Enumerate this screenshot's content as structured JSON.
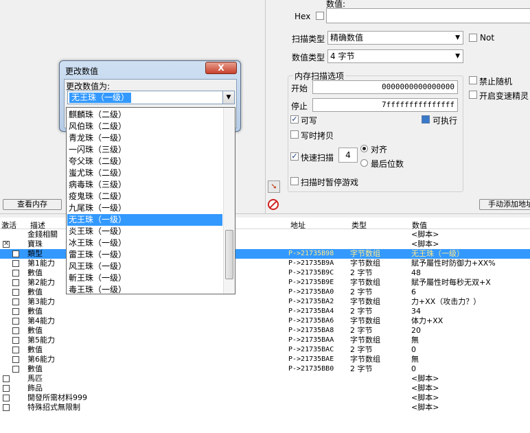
{
  "left_panel": {
    "view_memory_button": "查看内存"
  },
  "right_panel": {
    "value_label": "数值:",
    "hex_label": "Hex",
    "hex_checked": false,
    "scan_type_label": "扫描类型",
    "scan_type_value": "精确数值",
    "not_label": "Not",
    "value_type_label": "数值类型",
    "value_type_value": "4 字节",
    "mem_options_title": "内存扫描选项",
    "start_label": "开始",
    "start_value": "0000000000000000",
    "stop_label": "停止",
    "stop_value": "7fffffffffffffff",
    "writable_label": "可写",
    "writable_checked": true,
    "executable_label": "可执行",
    "executable_checked": true,
    "copy_on_write_label": "写时拷贝",
    "fast_scan_label": "快速扫描",
    "fast_scan_checked": true,
    "fast_scan_value": "4",
    "align_label": "对齐",
    "last_digit_label": "最后位数",
    "pause_label": "扫描时暂停游戏",
    "disable_random_label": "禁止随机",
    "speedhack_label": "开启变速精灵",
    "manual_add_button": "手动添加地址"
  },
  "table": {
    "headers": {
      "active": "激活",
      "desc": "描述",
      "address": "地址",
      "type": "类型",
      "value": "数值"
    },
    "rows": [
      {
        "indent": 1,
        "box": "none",
        "desc": "金錢相關",
        "address": "",
        "type": "",
        "value": "<脚本>",
        "selected": false
      },
      {
        "indent": 1,
        "box": "x",
        "desc": "寶珠",
        "address": "",
        "type": "",
        "value": "<脚本>",
        "selected": false
      },
      {
        "indent": 2,
        "box": "empty",
        "desc": "類型",
        "address": "P->21735B98",
        "type": "字节数组",
        "value": "无王珠（一级）",
        "selected": true
      },
      {
        "indent": 2,
        "box": "empty",
        "desc": "第1能力",
        "address": "P->21735B9A",
        "type": "字节数组",
        "value": "賦予屬性时防御力+XX%",
        "selected": false
      },
      {
        "indent": 2,
        "box": "empty",
        "desc": "數值",
        "address": "P->21735B9C",
        "type": "2 字节",
        "value": "48",
        "selected": false
      },
      {
        "indent": 2,
        "box": "empty",
        "desc": "第2能力",
        "address": "P->21735B9E",
        "type": "字节数组",
        "value": "賦予屬性时每秒无双+X",
        "selected": false
      },
      {
        "indent": 2,
        "box": "empty",
        "desc": "數值",
        "address": "P->21735BA0",
        "type": "2 字节",
        "value": "6",
        "selected": false
      },
      {
        "indent": 2,
        "box": "empty",
        "desc": "第3能力",
        "address": "P->21735BA2",
        "type": "字节数组",
        "value": "力+XX（攻击力？）",
        "selected": false
      },
      {
        "indent": 2,
        "box": "empty",
        "desc": "數值",
        "address": "P->21735BA4",
        "type": "2 字节",
        "value": "34",
        "selected": false
      },
      {
        "indent": 2,
        "box": "empty",
        "desc": "第4能力",
        "address": "P->21735BA6",
        "type": "字节数组",
        "value": "体力+XX",
        "selected": false
      },
      {
        "indent": 2,
        "box": "empty",
        "desc": "數值",
        "address": "P->21735BA8",
        "type": "2 字节",
        "value": "20",
        "selected": false
      },
      {
        "indent": 2,
        "box": "empty",
        "desc": "第5能力",
        "address": "P->21735BAA",
        "type": "字节数组",
        "value": "無",
        "selected": false
      },
      {
        "indent": 2,
        "box": "empty",
        "desc": "數值",
        "address": "P->21735BAC",
        "type": "2 字节",
        "value": "0",
        "selected": false
      },
      {
        "indent": 2,
        "box": "empty",
        "desc": "第6能力",
        "address": "P->21735BAE",
        "type": "字节数组",
        "value": "無",
        "selected": false
      },
      {
        "indent": 2,
        "box": "empty",
        "desc": "數值",
        "address": "P->21735BB0",
        "type": "2 字节",
        "value": "0",
        "selected": false
      },
      {
        "indent": 0,
        "box": "empty",
        "desc": "馬匹",
        "address": "",
        "type": "",
        "value": "<脚本>",
        "selected": false
      },
      {
        "indent": 0,
        "box": "empty",
        "desc": "飾品",
        "address": "",
        "type": "",
        "value": "<脚本>",
        "selected": false
      },
      {
        "indent": 0,
        "box": "empty",
        "desc": "開發所需材料999",
        "address": "",
        "type": "",
        "value": "<脚本>",
        "selected": false
      },
      {
        "indent": 0,
        "box": "empty",
        "desc": "特殊招式無限制",
        "address": "",
        "type": "",
        "value": "<脚本>",
        "selected": false
      }
    ]
  },
  "dialog": {
    "title": "更改数值",
    "close_label": "X",
    "label": "更改数值为:",
    "current_value": "无王珠（一级）",
    "options": [
      "麒麟珠（二级）",
      "风伯珠（二级）",
      "青龙珠（一级）",
      "一闪珠（三级）",
      "夸父珠（二级）",
      "蚩尤珠（二级）",
      "病毒珠（三级）",
      "疫鬼珠（二级）",
      "九尾珠（一级）",
      "无王珠（一级）",
      "炎王珠（一级）",
      "冰王珠（一级）",
      "雷王珠（一级）",
      "风王珠（一级）",
      "斬王珠（一级）",
      "毒王珠（一级）"
    ],
    "selected_index": 9
  }
}
